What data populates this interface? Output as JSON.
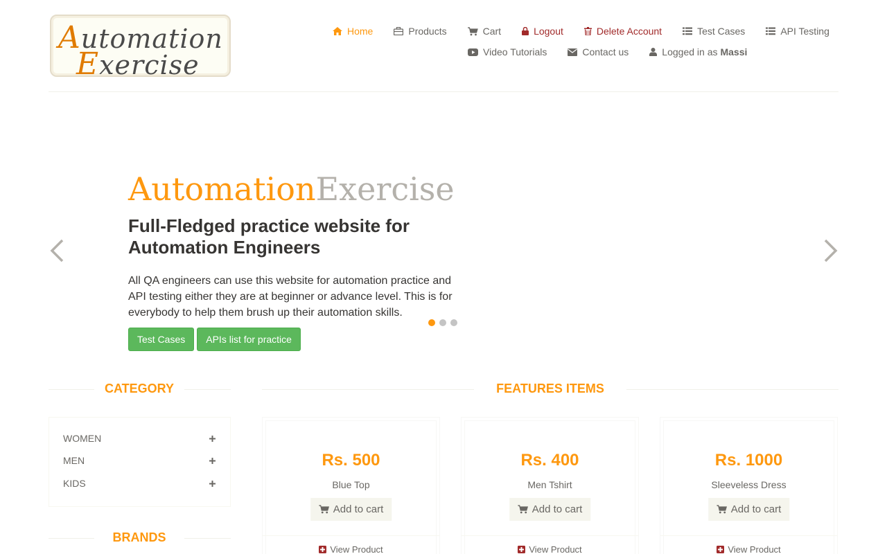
{
  "logo": {
    "line1_cap": "A",
    "line1_rest": "utomation",
    "line2_cap": "E",
    "line2_rest": "xercise"
  },
  "nav": {
    "home": "Home",
    "products": "Products",
    "cart": "Cart",
    "logout": "Logout",
    "delete_account": "Delete Account",
    "test_cases": "Test Cases",
    "api_testing": "API Testing",
    "video_tutorials": "Video Tutorials",
    "contact_us": "Contact us",
    "logged_in_prefix": "Logged in as",
    "username": "Massi"
  },
  "hero": {
    "brand_a": "Automation",
    "brand_e": "Exercise",
    "title": "Full-Fledged practice website for Automation Engineers",
    "description": "All QA engineers can use this website for automation practice and API testing either they are at beginner or advance level. This is for everybody to help them brush up their automation skills.",
    "btn_test_cases": "Test Cases",
    "btn_apis": "APIs list for practice",
    "active_slide": 1,
    "slide_count": 3
  },
  "category": {
    "title": "Category",
    "items": [
      {
        "label": "WOMEN"
      },
      {
        "label": "MEN"
      },
      {
        "label": "KIDS"
      }
    ]
  },
  "brands": {
    "title": "Brands"
  },
  "features": {
    "title": "Features Items",
    "products": [
      {
        "price": "Rs. 500",
        "name": "Blue Top",
        "add_label": "Add to cart",
        "view_label": "View Product"
      },
      {
        "price": "Rs. 400",
        "name": "Men Tshirt",
        "add_label": "Add to cart",
        "view_label": "View Product"
      },
      {
        "price": "Rs. 1000",
        "name": "Sleeveless Dress",
        "add_label": "Add to cart",
        "view_label": "View Product"
      }
    ]
  },
  "colors": {
    "accent": "#fe980f",
    "danger": "#a12a2a",
    "success": "#5cb85c",
    "text": "#696763"
  }
}
